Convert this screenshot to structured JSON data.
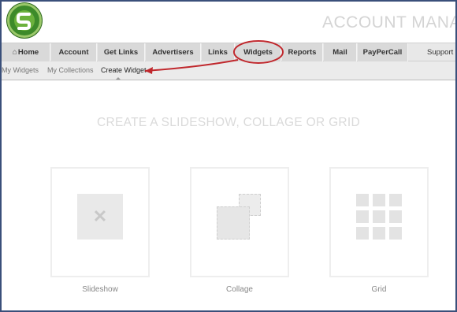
{
  "header": {
    "title": "ACCOUNT MANAG"
  },
  "nav": {
    "items": [
      {
        "label": "Home",
        "icon": "home-icon"
      },
      {
        "label": "Account"
      },
      {
        "label": "Get Links"
      },
      {
        "label": "Advertisers"
      },
      {
        "label": "Links"
      },
      {
        "label": "Widgets"
      },
      {
        "label": "Reports"
      },
      {
        "label": "Mail"
      },
      {
        "label": "PayPerCall"
      },
      {
        "label": "Support C"
      }
    ],
    "active": "Widgets"
  },
  "subnav": {
    "items": [
      {
        "label": "My Widgets"
      },
      {
        "label": "My Collections"
      },
      {
        "label": "Create Widget"
      }
    ],
    "active": "Create Widget"
  },
  "main": {
    "title": "CREATE A SLIDESHOW, COLLAGE OR GRID",
    "options": [
      {
        "label": "Slideshow",
        "icon": "slideshow-placeholder-icon"
      },
      {
        "label": "Collage",
        "icon": "collage-icon"
      },
      {
        "label": "Grid",
        "icon": "grid-icon"
      }
    ]
  },
  "annotations": {
    "highlight_color": "#c0282d"
  },
  "colors": {
    "frame_border": "#3a4f7a",
    "logo_green": "#3d8a2a",
    "nav_bg": "#d9d9d9"
  }
}
